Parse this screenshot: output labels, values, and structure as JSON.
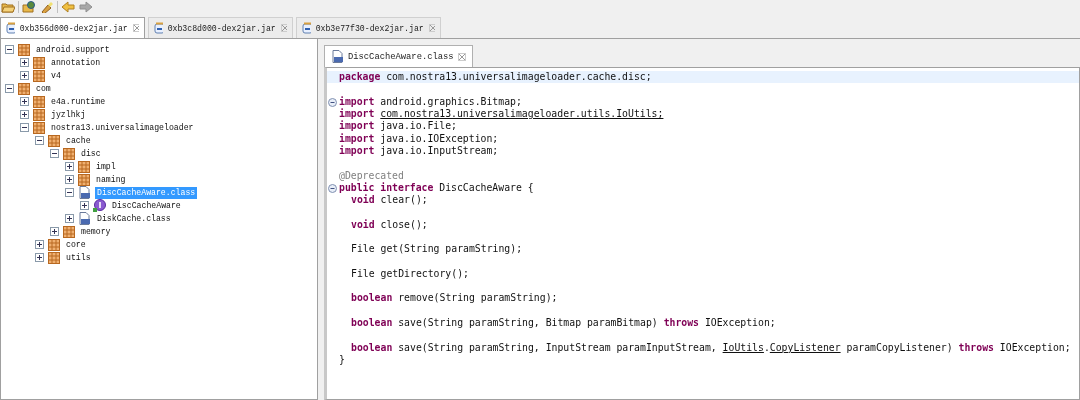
{
  "toolbar": {
    "buttons": [
      {
        "kind": "open"
      },
      {
        "kind": "open-type"
      },
      {
        "kind": "search"
      },
      {
        "kind": "back",
        "disabled": false
      },
      {
        "kind": "forward",
        "disabled": true
      }
    ]
  },
  "file_tabs": [
    {
      "label": "0xb356d000-dex2jar.jar",
      "selected": true
    },
    {
      "label": "0xb3c8d000-dex2jar.jar",
      "selected": false
    },
    {
      "label": "0xb3e77f30-dex2jar.jar",
      "selected": false
    }
  ],
  "tree": [
    {
      "label": "android.support",
      "kind": "package",
      "expanded": true,
      "selected": false,
      "children": [
        {
          "label": "annotation",
          "kind": "package",
          "expanded": false,
          "selected": false
        },
        {
          "label": "v4",
          "kind": "package",
          "expanded": false,
          "selected": false
        }
      ]
    },
    {
      "label": "com",
      "kind": "package",
      "expanded": true,
      "selected": false,
      "children": [
        {
          "label": "e4a.runtime",
          "kind": "package",
          "expanded": false,
          "selected": false
        },
        {
          "label": "jyzlhkj",
          "kind": "package",
          "expanded": false,
          "selected": false
        },
        {
          "label": "nostra13.universalimageloader",
          "kind": "package",
          "expanded": true,
          "selected": false,
          "children": [
            {
              "label": "cache",
              "kind": "package",
              "expanded": true,
              "selected": false,
              "children": [
                {
                  "label": "disc",
                  "kind": "package",
                  "expanded": true,
                  "selected": false,
                  "children": [
                    {
                      "label": "impl",
                      "kind": "package",
                      "expanded": false,
                      "selected": false
                    },
                    {
                      "label": "naming",
                      "kind": "package",
                      "expanded": false,
                      "selected": false
                    },
                    {
                      "label": "DiscCacheAware.class",
                      "kind": "classfile",
                      "expanded": true,
                      "selected": true,
                      "children": [
                        {
                          "label": "DiscCacheAware",
                          "kind": "interface",
                          "expanded": false,
                          "selected": false
                        }
                      ]
                    },
                    {
                      "label": "DiskCache.class",
                      "kind": "classfile",
                      "expanded": false,
                      "selected": false
                    }
                  ]
                },
                {
                  "label": "memory",
                  "kind": "package",
                  "expanded": false,
                  "selected": false
                }
              ]
            },
            {
              "label": "core",
              "kind": "package",
              "expanded": false,
              "selected": false
            },
            {
              "label": "utils",
              "kind": "package",
              "expanded": false,
              "selected": false
            }
          ]
        }
      ]
    }
  ],
  "editor_tab": {
    "label": "DiscCacheAware.class",
    "selected": true
  },
  "code": [
    {
      "current": true,
      "fold": false,
      "blank_before": false,
      "indent": false,
      "spans": [
        {
          "kind": "keyword",
          "text": "package"
        },
        {
          "kind": "plain",
          "text": " com.nostra13.universalimageloader.cache.disc;"
        }
      ]
    },
    {
      "current": false,
      "fold": true,
      "blank_before": true,
      "indent": false,
      "spans": [
        {
          "kind": "keyword",
          "text": "import"
        },
        {
          "kind": "plain",
          "text": " android.graphics.Bitmap;"
        }
      ]
    },
    {
      "current": false,
      "fold": false,
      "blank_before": false,
      "indent": false,
      "spans": [
        {
          "kind": "keyword",
          "text": "import "
        },
        {
          "kind": "link",
          "text": "com.nostra13.universalimageloader.utils.IoUtils;"
        }
      ]
    },
    {
      "current": false,
      "fold": false,
      "blank_before": false,
      "indent": false,
      "spans": [
        {
          "kind": "keyword",
          "text": "import"
        },
        {
          "kind": "plain",
          "text": " java.io.File;"
        }
      ]
    },
    {
      "current": false,
      "fold": false,
      "blank_before": false,
      "indent": false,
      "spans": [
        {
          "kind": "keyword",
          "text": "import"
        },
        {
          "kind": "plain",
          "text": " java.io.IOException;"
        }
      ]
    },
    {
      "current": false,
      "fold": false,
      "blank_before": false,
      "indent": false,
      "spans": [
        {
          "kind": "keyword",
          "text": "import"
        },
        {
          "kind": "plain",
          "text": " java.io.InputStream;"
        }
      ]
    },
    {
      "current": false,
      "fold": false,
      "blank_before": true,
      "indent": false,
      "spans": [
        {
          "kind": "annotation",
          "text": "@Deprecated"
        }
      ]
    },
    {
      "current": false,
      "fold": true,
      "blank_before": false,
      "indent": false,
      "spans": [
        {
          "kind": "keyword",
          "text": "public interface"
        },
        {
          "kind": "plain",
          "text": " DiscCacheAware {"
        }
      ]
    },
    {
      "current": false,
      "fold": false,
      "blank_before": false,
      "indent": true,
      "spans": [
        {
          "kind": "keyword",
          "text": "void"
        },
        {
          "kind": "plain",
          "text": " clear();"
        }
      ]
    },
    {
      "current": false,
      "fold": false,
      "blank_before": true,
      "indent": true,
      "spans": [
        {
          "kind": "keyword",
          "text": "void"
        },
        {
          "kind": "plain",
          "text": " close();"
        }
      ]
    },
    {
      "current": false,
      "fold": false,
      "blank_before": true,
      "indent": true,
      "spans": [
        {
          "kind": "plain",
          "text": "File get(String paramString);"
        }
      ]
    },
    {
      "current": false,
      "fold": false,
      "blank_before": true,
      "indent": true,
      "spans": [
        {
          "kind": "plain",
          "text": "File getDirectory();"
        }
      ]
    },
    {
      "current": false,
      "fold": false,
      "blank_before": true,
      "indent": true,
      "spans": [
        {
          "kind": "keyword",
          "text": "boolean"
        },
        {
          "kind": "plain",
          "text": " remove(String paramString);"
        }
      ]
    },
    {
      "current": false,
      "fold": false,
      "blank_before": true,
      "indent": true,
      "spans": [
        {
          "kind": "keyword",
          "text": "boolean"
        },
        {
          "kind": "plain",
          "text": " save(String paramString, Bitmap paramBitmap) "
        },
        {
          "kind": "keyword",
          "text": "throws"
        },
        {
          "kind": "plain",
          "text": " IOException;"
        }
      ]
    },
    {
      "current": false,
      "fold": false,
      "blank_before": true,
      "indent": true,
      "spans": [
        {
          "kind": "keyword",
          "text": "boolean"
        },
        {
          "kind": "plain",
          "text": " save(String paramString, InputStream paramInputStream, "
        },
        {
          "kind": "link",
          "text": "IoUtils"
        },
        {
          "kind": "plain",
          "text": "."
        },
        {
          "kind": "link",
          "text": "CopyListener"
        },
        {
          "kind": "plain",
          "text": " paramCopyListener) "
        },
        {
          "kind": "keyword",
          "text": "throws"
        },
        {
          "kind": "plain",
          "text": " IOException;"
        }
      ]
    },
    {
      "current": false,
      "fold": false,
      "blank_before": false,
      "indent": false,
      "spans": [
        {
          "kind": "plain",
          "text": "}"
        }
      ]
    }
  ]
}
